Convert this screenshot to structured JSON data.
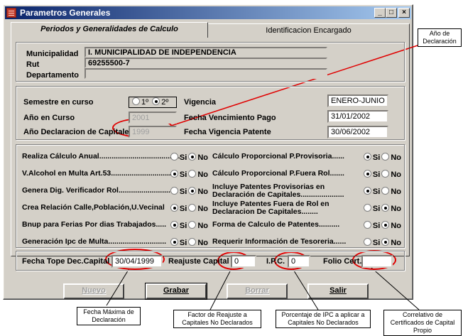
{
  "window": {
    "title": "Parametros Generales",
    "buttons": {
      "minimize": "_",
      "maximize": "□",
      "close": "×"
    }
  },
  "tabs": [
    {
      "label": "Periodos y Generalidades de Calculo",
      "active": true
    },
    {
      "label": "Identificacion Encargado",
      "active": false
    }
  ],
  "municipalidad": {
    "municipalidad_label": "Municipalidad",
    "municipalidad_value": "I. MUNICIPALIDAD DE INDEPENDENCIA",
    "rut_label": "Rut",
    "rut_value": "69255500-7",
    "departamento_label": "Departamento",
    "departamento_value": ""
  },
  "periodo": {
    "semestre_label": "Semestre en curso",
    "semestre_options": [
      "1º",
      "2º"
    ],
    "semestre_selected": "2º",
    "anio_curso_label": "Año en Curso",
    "anio_curso_value": "2001",
    "anio_declaracion_label": "Año Declaracion de Capitales",
    "anio_declaracion_value": "1999",
    "vigencia_label": "Vigencia",
    "vigencia_value": "ENERO-JUNIO",
    "fecha_venc_label": "Fecha Vencimiento Pago",
    "fecha_venc_value": "31/01/2002",
    "fecha_vig_label": "Fecha Vigencia Patente",
    "fecha_vig_value": "30/06/2002"
  },
  "options": {
    "si": "Si",
    "no": "No",
    "left": [
      {
        "label": "Realiza Cálculo Anual.......................................",
        "selected": "No"
      },
      {
        "label": "V.Alcohol en Multa Art.53.............................",
        "selected": "Si"
      },
      {
        "label": "Genera Dig. Verificador Rol.........................",
        "selected": "No"
      },
      {
        "label": "Crea Relación Calle,Población,U.Vecinal",
        "selected": "Si"
      },
      {
        "label": "Bnup para Ferias Por dias Trabajados.....",
        "selected": "Si"
      },
      {
        "label": "Generación  Ipc de Multa............................",
        "selected": "Si"
      }
    ],
    "right": [
      {
        "label": "Cálculo Proporcional P.Provisoria......",
        "selected": "Si"
      },
      {
        "label": "Cálculo Proporcional P.Fuera Rol.......",
        "selected": "Si"
      },
      {
        "label": "Incluye Patentes Provisorias en",
        "label2": "Declaración de Capitales.....................",
        "selected": "Si"
      },
      {
        "label": "Incluye Patentes Fuera de Rol en",
        "label2": "Declaracion De Capitales........",
        "selected": "No"
      },
      {
        "label": "Forma de Calculo de Patentes..........",
        "selected": "No"
      },
      {
        "label": "Requerir Información de Tesoreria......",
        "selected": "No"
      }
    ]
  },
  "bottom": {
    "fecha_tope_label": "Fecha Tope Dec.Capital",
    "fecha_tope_value": "30/04/1999",
    "reajuste_label": "Reajuste Capital",
    "reajuste_value": "0",
    "ipc_label": "I.P.C.",
    "ipc_value": "0",
    "folio_label": "Folio Cert.",
    "folio_value": ""
  },
  "actions": {
    "nuevo": "Nuevo",
    "grabar": "Grabar",
    "borrar": "Borrar",
    "salir": "Salir"
  },
  "annotations": {
    "anio_declaracion": "Año de Declaración",
    "fecha_maxima": "Fecha Máxima de Declaración",
    "factor_reajuste": "Factor de Reajuste a Capitales No Declarados",
    "porcentaje_ipc": "Porcentaje de IPC a aplicar a Capitales No Declarados",
    "correlativo": "Correlativo de Certificados de Capital Propio",
    "color": "#e00000"
  }
}
